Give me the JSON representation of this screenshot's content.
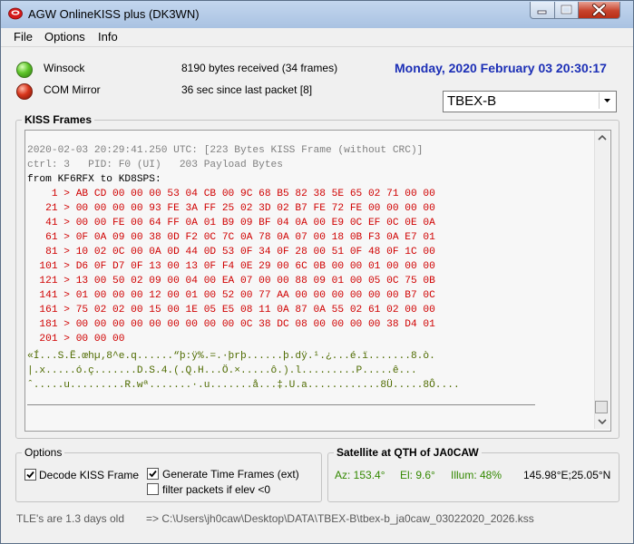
{
  "window": {
    "title": "AGW OnlineKISS plus (DK3WN)"
  },
  "menu": {
    "file": "File",
    "options": "Options",
    "info": "Info"
  },
  "status": {
    "winsock_label": "Winsock",
    "com_mirror_label": "COM Mirror",
    "bytes_received": "8190 bytes received (34 frames)",
    "last_packet": "36 sec since last packet [8]",
    "datetime": "Monday, 2020 February 03  20:30:17"
  },
  "satellite_select": {
    "value": "TBEX-B"
  },
  "kiss_frames": {
    "title": "KISS Frames",
    "lines": [
      "2020-02-03 20:29:41.250 UTC: [223 Bytes KISS Frame (without CRC)]",
      "ctrl: 3   PID: F0 (UI)   203 Payload Bytes",
      "from KF6RFX to KD8SPS:",
      "    1 > AB CD 00 00 00 53 04 CB 00 9C 68 B5 82 38 5E 65 02 71 00 00",
      "   21 > 00 00 00 00 93 FE 3A FF 25 02 3D 02 B7 FE 72 FE 00 00 00 00",
      "   41 > 00 00 FE 00 64 FF 0A 01 B9 09 BF 04 0A 00 E9 0C EF 0C 0E 0A",
      "   61 > 0F 0A 09 00 38 0D F2 0C 7C 0A 78 0A 07 00 18 0B F3 0A E7 01",
      "   81 > 10 02 0C 00 0A 0D 44 0D 53 0F 34 0F 28 00 51 0F 48 0F 1C 00",
      "  101 > D6 0F D7 0F 13 00 13 0F F4 0E 29 00 6C 0B 00 00 01 00 00 00",
      "  121 > 13 00 50 02 09 00 04 00 EA 07 00 00 88 09 01 00 05 0C 75 0B",
      "  141 > 01 00 00 00 12 00 01 00 52 00 77 AA 00 00 00 00 00 00 B7 0C",
      "  161 > 75 02 02 00 15 00 1E 05 E5 08 11 0A 87 0A 55 02 61 02 00 00",
      "  181 > 00 00 00 00 00 00 00 00 00 0C 38 DC 08 00 00 00 00 38 D4 01",
      "  201 > 00 00 00",
      "«Í...S.Ë.œhµ‚8^e.q......“þ:ÿ%.=.·þrþ......þ.dÿ.¹.¿...é.ï.......8.ò.",
      "|.x.....ó.ç.......D.S.4.(.Q.H...Ö.×.....ô.).l.........P.....ê...",
      "ˆ.....u.........R.wª.......·.u.......å...‡.U.a............8Ü.....8Ô...."
    ]
  },
  "options": {
    "title": "Options",
    "decode_kiss": "Decode KISS Frame",
    "generate_time": "Generate Time Frames (ext)",
    "filter_packets": "filter packets if elev <0"
  },
  "satellite_info": {
    "title": "Satellite at QTH of JA0CAW",
    "az": "Az: 153.4°",
    "el": "El: 9.6°",
    "illum": "Illum: 48%",
    "position": "145.98°E;25.05°N"
  },
  "statusbar": {
    "tle_age": "TLE's are 1.3 days old",
    "log_path": "=> C:\\Users\\jh0caw\\Desktop\\DATA\\TBEX-B\\tbex-b_ja0caw_03022020_2026.kss"
  },
  "colors": {
    "title_blue": "#1c2fb6",
    "hex_red": "#d00000",
    "ascii_olive": "#4f6b00",
    "sat_green": "#338800"
  }
}
